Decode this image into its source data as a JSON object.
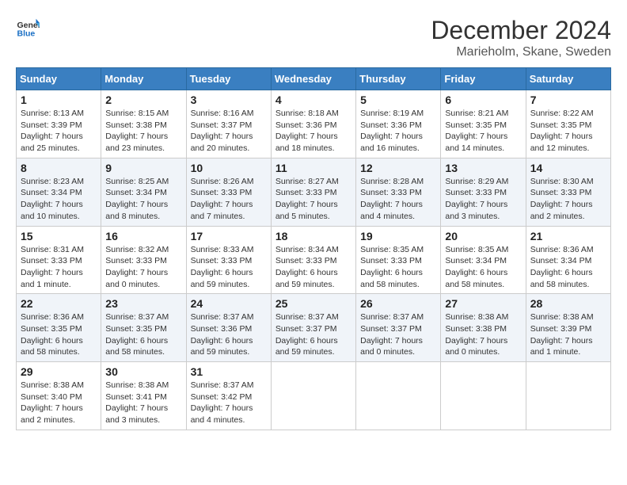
{
  "header": {
    "logo_line1": "General",
    "logo_line2": "Blue",
    "month_title": "December 2024",
    "location": "Marieholm, Skane, Sweden"
  },
  "weekdays": [
    "Sunday",
    "Monday",
    "Tuesday",
    "Wednesday",
    "Thursday",
    "Friday",
    "Saturday"
  ],
  "weeks": [
    [
      {
        "day": "1",
        "info": "Sunrise: 8:13 AM\nSunset: 3:39 PM\nDaylight: 7 hours\nand 25 minutes."
      },
      {
        "day": "2",
        "info": "Sunrise: 8:15 AM\nSunset: 3:38 PM\nDaylight: 7 hours\nand 23 minutes."
      },
      {
        "day": "3",
        "info": "Sunrise: 8:16 AM\nSunset: 3:37 PM\nDaylight: 7 hours\nand 20 minutes."
      },
      {
        "day": "4",
        "info": "Sunrise: 8:18 AM\nSunset: 3:36 PM\nDaylight: 7 hours\nand 18 minutes."
      },
      {
        "day": "5",
        "info": "Sunrise: 8:19 AM\nSunset: 3:36 PM\nDaylight: 7 hours\nand 16 minutes."
      },
      {
        "day": "6",
        "info": "Sunrise: 8:21 AM\nSunset: 3:35 PM\nDaylight: 7 hours\nand 14 minutes."
      },
      {
        "day": "7",
        "info": "Sunrise: 8:22 AM\nSunset: 3:35 PM\nDaylight: 7 hours\nand 12 minutes."
      }
    ],
    [
      {
        "day": "8",
        "info": "Sunrise: 8:23 AM\nSunset: 3:34 PM\nDaylight: 7 hours\nand 10 minutes."
      },
      {
        "day": "9",
        "info": "Sunrise: 8:25 AM\nSunset: 3:34 PM\nDaylight: 7 hours\nand 8 minutes."
      },
      {
        "day": "10",
        "info": "Sunrise: 8:26 AM\nSunset: 3:33 PM\nDaylight: 7 hours\nand 7 minutes."
      },
      {
        "day": "11",
        "info": "Sunrise: 8:27 AM\nSunset: 3:33 PM\nDaylight: 7 hours\nand 5 minutes."
      },
      {
        "day": "12",
        "info": "Sunrise: 8:28 AM\nSunset: 3:33 PM\nDaylight: 7 hours\nand 4 minutes."
      },
      {
        "day": "13",
        "info": "Sunrise: 8:29 AM\nSunset: 3:33 PM\nDaylight: 7 hours\nand 3 minutes."
      },
      {
        "day": "14",
        "info": "Sunrise: 8:30 AM\nSunset: 3:33 PM\nDaylight: 7 hours\nand 2 minutes."
      }
    ],
    [
      {
        "day": "15",
        "info": "Sunrise: 8:31 AM\nSunset: 3:33 PM\nDaylight: 7 hours\nand 1 minute."
      },
      {
        "day": "16",
        "info": "Sunrise: 8:32 AM\nSunset: 3:33 PM\nDaylight: 7 hours\nand 0 minutes."
      },
      {
        "day": "17",
        "info": "Sunrise: 8:33 AM\nSunset: 3:33 PM\nDaylight: 6 hours\nand 59 minutes."
      },
      {
        "day": "18",
        "info": "Sunrise: 8:34 AM\nSunset: 3:33 PM\nDaylight: 6 hours\nand 59 minutes."
      },
      {
        "day": "19",
        "info": "Sunrise: 8:35 AM\nSunset: 3:33 PM\nDaylight: 6 hours\nand 58 minutes."
      },
      {
        "day": "20",
        "info": "Sunrise: 8:35 AM\nSunset: 3:34 PM\nDaylight: 6 hours\nand 58 minutes."
      },
      {
        "day": "21",
        "info": "Sunrise: 8:36 AM\nSunset: 3:34 PM\nDaylight: 6 hours\nand 58 minutes."
      }
    ],
    [
      {
        "day": "22",
        "info": "Sunrise: 8:36 AM\nSunset: 3:35 PM\nDaylight: 6 hours\nand 58 minutes."
      },
      {
        "day": "23",
        "info": "Sunrise: 8:37 AM\nSunset: 3:35 PM\nDaylight: 6 hours\nand 58 minutes."
      },
      {
        "day": "24",
        "info": "Sunrise: 8:37 AM\nSunset: 3:36 PM\nDaylight: 6 hours\nand 59 minutes."
      },
      {
        "day": "25",
        "info": "Sunrise: 8:37 AM\nSunset: 3:37 PM\nDaylight: 6 hours\nand 59 minutes."
      },
      {
        "day": "26",
        "info": "Sunrise: 8:37 AM\nSunset: 3:37 PM\nDaylight: 7 hours\nand 0 minutes."
      },
      {
        "day": "27",
        "info": "Sunrise: 8:38 AM\nSunset: 3:38 PM\nDaylight: 7 hours\nand 0 minutes."
      },
      {
        "day": "28",
        "info": "Sunrise: 8:38 AM\nSunset: 3:39 PM\nDaylight: 7 hours\nand 1 minute."
      }
    ],
    [
      {
        "day": "29",
        "info": "Sunrise: 8:38 AM\nSunset: 3:40 PM\nDaylight: 7 hours\nand 2 minutes."
      },
      {
        "day": "30",
        "info": "Sunrise: 8:38 AM\nSunset: 3:41 PM\nDaylight: 7 hours\nand 3 minutes."
      },
      {
        "day": "31",
        "info": "Sunrise: 8:37 AM\nSunset: 3:42 PM\nDaylight: 7 hours\nand 4 minutes."
      },
      {
        "day": "",
        "info": ""
      },
      {
        "day": "",
        "info": ""
      },
      {
        "day": "",
        "info": ""
      },
      {
        "day": "",
        "info": ""
      }
    ]
  ]
}
